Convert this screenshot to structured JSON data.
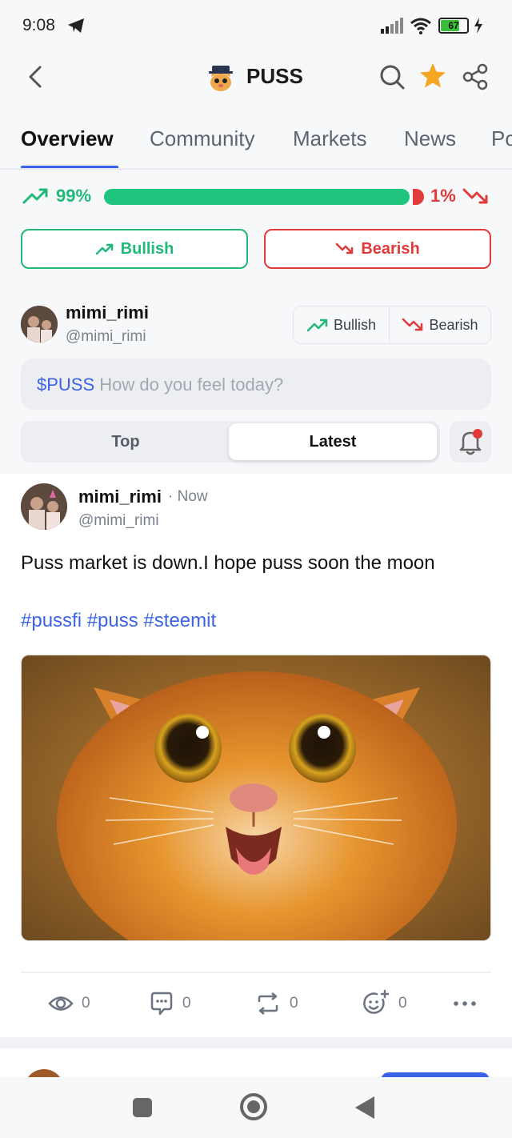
{
  "status_bar": {
    "time": "9:08",
    "battery": "67"
  },
  "header": {
    "title": "PUSS"
  },
  "tabs": [
    {
      "label": "Overview"
    },
    {
      "label": "Community"
    },
    {
      "label": "Markets"
    },
    {
      "label": "News"
    },
    {
      "label": "Po"
    }
  ],
  "sentiment": {
    "bullish_pct": "99%",
    "bearish_pct": "1%",
    "bullish_fraction": 0.99
  },
  "vote": {
    "bullish_label": "Bullish",
    "bearish_label": "Bearish"
  },
  "composer": {
    "name": "mimi_rimi",
    "handle": "@mimi_rimi",
    "bullish_label": "Bullish",
    "bearish_label": "Bearish",
    "ticker": "$PUSS",
    "placeholder": "How do you feel today?"
  },
  "sort": {
    "top_label": "Top",
    "latest_label": "Latest"
  },
  "post": {
    "name": "mimi_rimi",
    "time": "· Now",
    "handle": "@mimi_rimi",
    "text": "Puss market is down.I hope puss soon the moon",
    "tags": "#pussfi #puss #steemit",
    "views": "0",
    "comments": "0",
    "reposts": "0",
    "reactions": "0"
  },
  "colors": {
    "bullish": "#20b97a",
    "bearish": "#e03a3a",
    "accent": "#3b63e8"
  }
}
